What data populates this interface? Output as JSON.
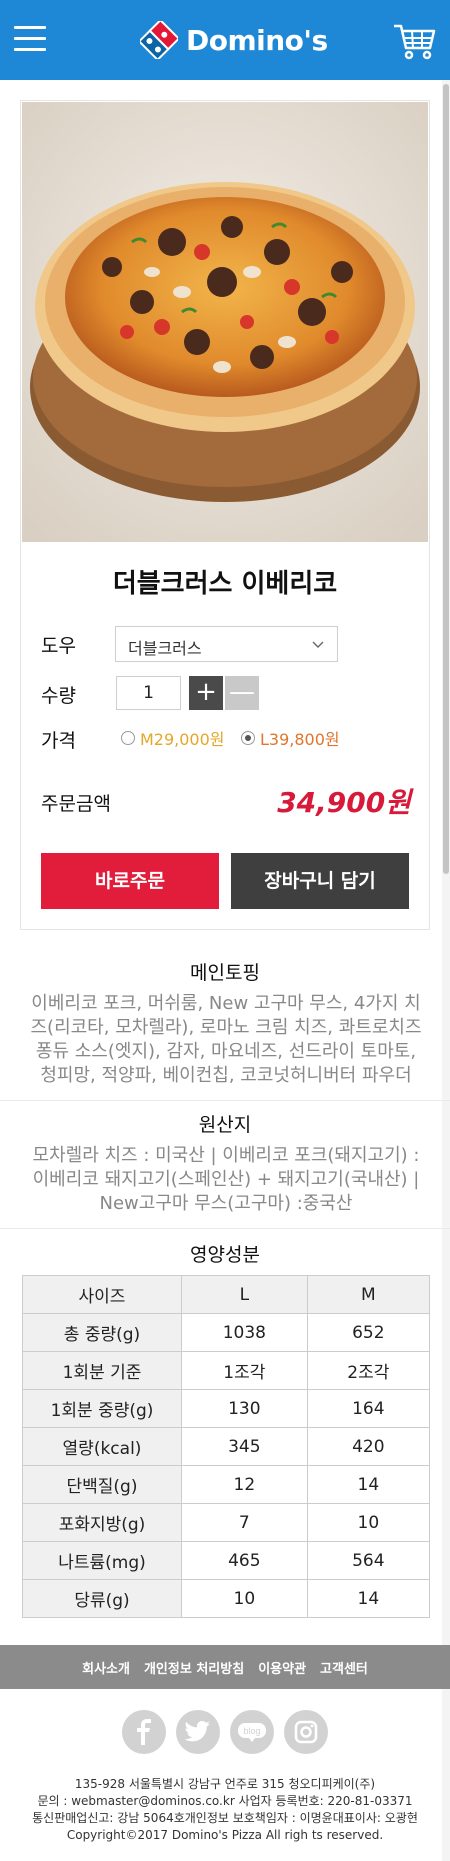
{
  "header": {
    "brand": "Domino's",
    "menu_icon": "hamburger-menu-icon",
    "cart_icon": "shopping-cart-icon",
    "logo_colors": {
      "red": "#e31837",
      "blue": "#0b64a4",
      "header_bg": "#1e88d6"
    }
  },
  "product": {
    "name": "더블크러스 이베리코",
    "image": "pizza-photo",
    "dough": {
      "label": "도우",
      "selected": "더블크러스"
    },
    "quantity": {
      "label": "수량",
      "value": "1",
      "plus": "+",
      "minus": "—"
    },
    "price": {
      "label": "가격",
      "options": [
        {
          "text": "M29,000원",
          "selected": false
        },
        {
          "text": "L39,800원",
          "selected": true
        }
      ]
    },
    "total": {
      "label": "주문금액",
      "value": "34,900원"
    },
    "buttons": {
      "order": "바로주문",
      "cart": "장바구니 담기"
    }
  },
  "main_topping": {
    "title": "메인토핑",
    "lines": [
      "이베리코 포크, 머쉬룸, New 고구마 무스, 4가지 치",
      "즈(리코타, 모차렐라), 로마노 크림 치즈, 콰트로치즈",
      "퐁듀 소스(엣지), 감자, 마요네즈, 선드라이 토마토,",
      "청피망, 적양파, 베이컨칩, 코코넛허니버터 파우더"
    ]
  },
  "origin": {
    "title": "원산지",
    "lines": [
      "모차렐라 치즈 : 미국산 | 이베리코 포크(돼지고기) :",
      "이베리코 돼지고기(스페인산) + 돼지고기(국내산) |",
      "New고구마 무스(고구마) :중국산"
    ]
  },
  "nutrition": {
    "title": "영양성분",
    "header": [
      "사이즈",
      "L",
      "M"
    ],
    "rows": [
      [
        "총 중량(g)",
        "1038",
        "652"
      ],
      [
        "1회분 기준",
        "1조각",
        "2조각"
      ],
      [
        "1회분 중량(g)",
        "130",
        "164"
      ],
      [
        "열량(kcal)",
        "345",
        "420"
      ],
      [
        "단백질(g)",
        "12",
        "14"
      ],
      [
        "포화지방(g)",
        "7",
        "10"
      ],
      [
        "나트륨(mg)",
        "465",
        "564"
      ],
      [
        "당류(g)",
        "10",
        "14"
      ]
    ]
  },
  "footer": {
    "links": [
      "회사소개",
      "개인정보 처리방침",
      "이용약관",
      "고객센터"
    ],
    "social_icons": [
      "facebook-icon",
      "twitter-icon",
      "blog-icon",
      "instagram-icon"
    ],
    "blog_label": "blog",
    "company_lines": [
      "135-928 서울특별시 강남구 언주로 315 청오디피케이(주)",
      "문의 : webmaster@dominos.co.kr 사업자 등록번호: 220-81-03371",
      "통신판매업신고: 강남 5064호개인정보 보호책임자 : 이명윤대표이사: 오광현",
      "Copyright©2017 Domino's Pizza All righ ts reserved."
    ]
  }
}
